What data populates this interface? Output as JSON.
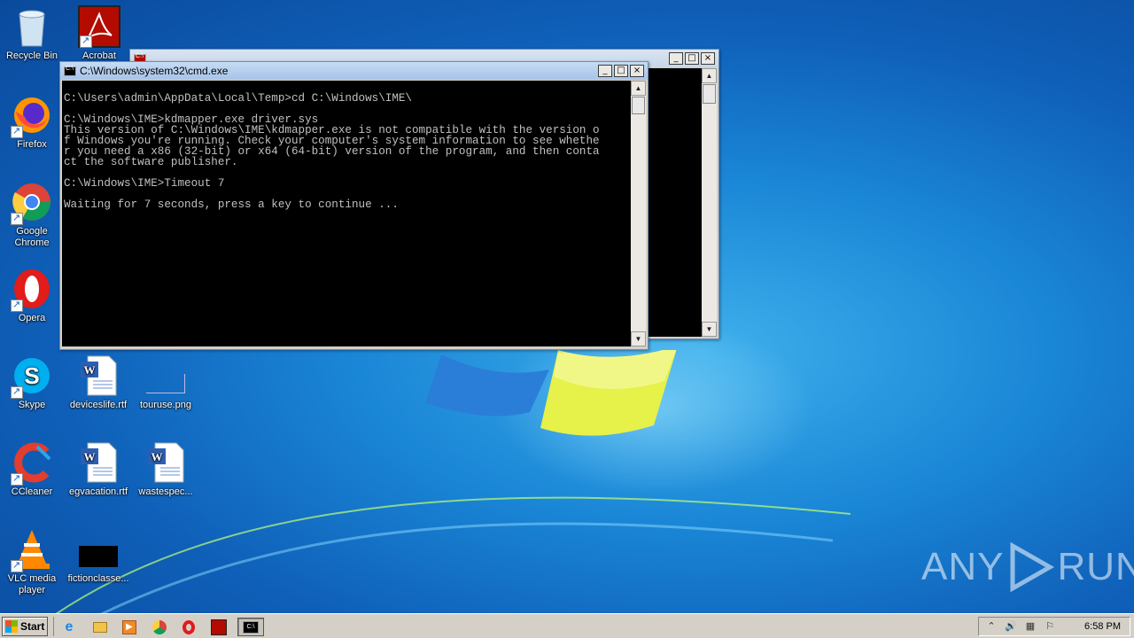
{
  "desktop": {
    "icons": [
      {
        "label": "Recycle Bin",
        "icon": "recycle-bin-icon"
      },
      {
        "label": "Acrobat",
        "icon": "acrobat-icon"
      },
      {
        "label": "Firefox",
        "icon": "firefox-icon"
      },
      {
        "label": "Google Chrome",
        "icon": "chrome-icon"
      },
      {
        "label": "Opera",
        "icon": "opera-icon"
      },
      {
        "label": "Skype",
        "icon": "skype-icon"
      },
      {
        "label": "deviceslife.rtf",
        "icon": "word-doc-icon"
      },
      {
        "label": "touruse.png",
        "icon": "image-file-icon"
      },
      {
        "label": "CCleaner",
        "icon": "ccleaner-icon"
      },
      {
        "label": "egvacation.rtf",
        "icon": "word-doc-icon"
      },
      {
        "label": "wastespec...",
        "icon": "word-doc-icon"
      },
      {
        "label": "VLC media player",
        "icon": "vlc-icon"
      },
      {
        "label": "fictionclasse...",
        "icon": "image-file-icon"
      }
    ]
  },
  "back_window": {
    "title": "",
    "controls": [
      "_",
      "□",
      "×"
    ]
  },
  "cmd_window": {
    "title": "C:\\Windows\\system32\\cmd.exe",
    "controls": [
      "_",
      "□",
      "×"
    ],
    "console_text": "\nC:\\Users\\admin\\AppData\\Local\\Temp>cd C:\\Windows\\IME\\\n\nC:\\Windows\\IME>kdmapper.exe driver.sys\nThis version of C:\\Windows\\IME\\kdmapper.exe is not compatible with the version o\nf Windows you're running. Check your computer's system information to see whethe\nr you need a x86 (32-bit) or x64 (64-bit) version of the program, and then conta\nct the software publisher.\n\nC:\\Windows\\IME>Timeout 7\n\nWaiting for 7 seconds, press a key to continue ..."
  },
  "taskbar": {
    "start_label": "Start",
    "pinned": [
      "ie-icon",
      "explorer-icon",
      "media-player-icon",
      "chrome-icon",
      "opera-icon",
      "acrobat-icon",
      "cmd-icon"
    ],
    "clock": "6:58 PM"
  },
  "watermark": {
    "text_left": "ANY",
    "text_right": "RUN"
  }
}
